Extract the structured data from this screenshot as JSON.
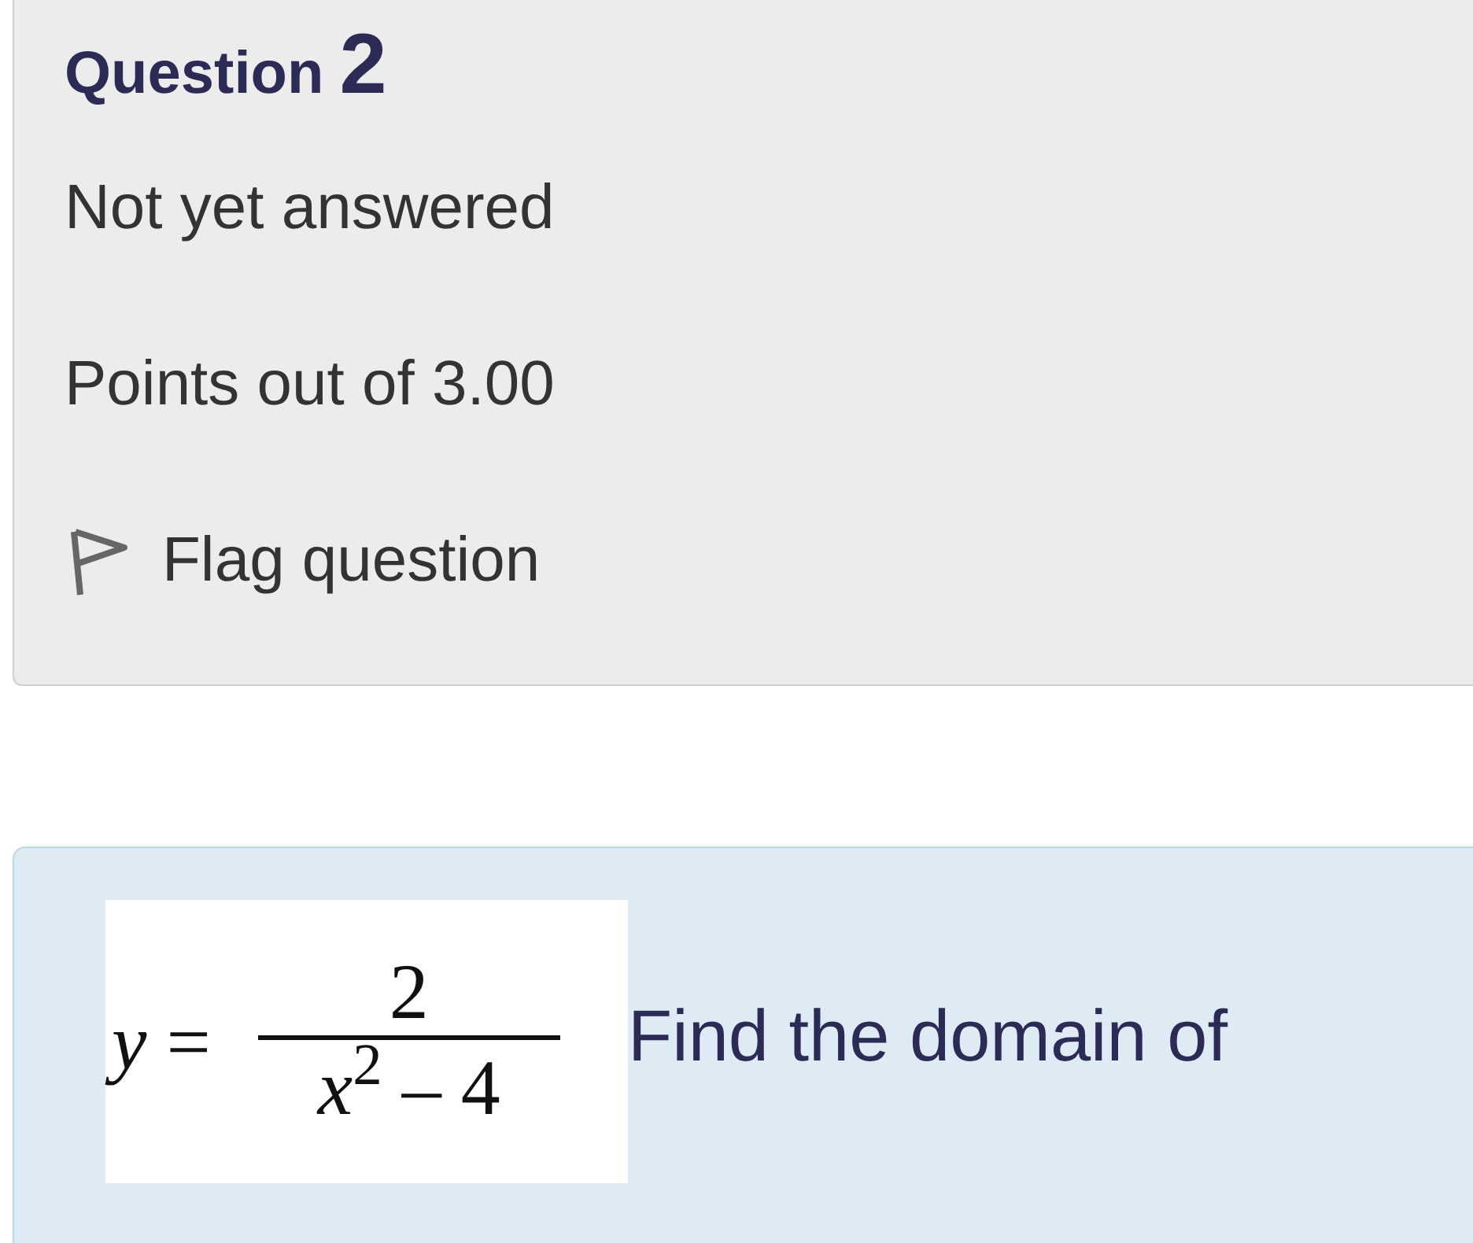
{
  "info": {
    "label": "Question",
    "number": "2",
    "state": "Not yet answered",
    "points": "Points out of 3.00",
    "flag": {
      "label": "Flag question",
      "flagged": false
    }
  },
  "question": {
    "formula": {
      "lhs": "*y* =",
      "numerator": "2",
      "denominator": "*x*$^{2}$ – 4"
    },
    "text": "Find the domain of"
  }
}
